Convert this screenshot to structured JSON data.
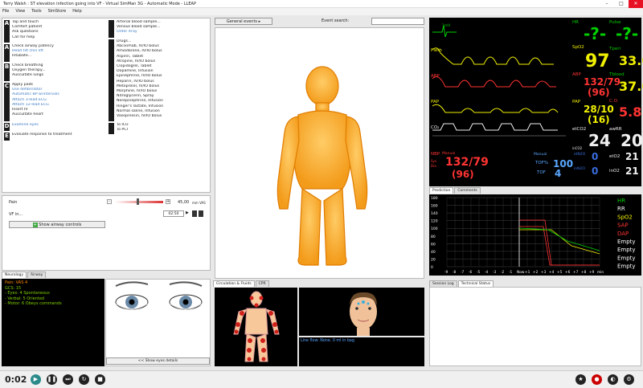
{
  "window": {
    "title": "Terry Walsh : ST elevation infection going into VF - Virtual SimMan 3G - Automatic Mode - LLEAP"
  },
  "menu": [
    "File",
    "View",
    "Tools",
    "SimStore",
    "Help"
  ],
  "actions": {
    "A": [
      "Tap and touch",
      "Comfort patient",
      "Ask questions",
      "Call for help"
    ],
    "A2": [
      "Check airway patency",
      "Head tilt chin lift",
      "Intubate..."
    ],
    "B": [
      "Check breathing",
      "Oxygen therapy...",
      "Auscultate lungs"
    ],
    "C": [
      "Apply pads",
      "Use defibrillator",
      "Automatic BP w/intervals",
      "Attach 3-lead ECG",
      "Attach 12-lead ECG",
      "Insert IV",
      "Auscultate heart"
    ],
    "D": [
      "Examine eyes"
    ],
    "E": [
      "Evaluate response to treatment"
    ],
    "R": [
      "Arterial blood sample...",
      "Venous blood sample...",
      "Order Xray"
    ],
    "Drugs": [
      "Drugs...",
      "Abciximab, IV/IO bolus",
      "Amiodarone, IV/IO bolus",
      "Aspirin, Tablet",
      "Atropine, IV/IO bolus",
      "Clopidogrel, Tablet",
      "Dopamine, Infusion",
      "Epinephrine, IV/IO bolus",
      "Heparin, IV/IO bolus",
      "Metoprolol, IV/IO bolus",
      "Morphine, IV/IO bolus",
      "Nitroglycerin, Spray",
      "Norepinephrine, Infusion",
      "Ringer's lactate, Infusion",
      "Normal saline, Infusion",
      "Vasopressin, IV/IO bolus"
    ],
    "Transfer": [
      "To ICU",
      "To PCI"
    ]
  },
  "pain": {
    "label": "Pain",
    "value": "45,00",
    "unit": "mm VAS"
  },
  "vf": {
    "label": "VF in...",
    "time": "02:50"
  },
  "airway_btn": "Show airway controls",
  "general_events": "General events",
  "event_search": "Event search:",
  "neuro": {
    "tabs": [
      "Neurology",
      "Airway"
    ],
    "lines": [
      "Pain: VAS 4",
      "GCS: 15",
      "- Eyes: 4 Spontaneous",
      "- Verbal: 5 Oriented",
      "- Motor: 6 Obeys commands"
    ],
    "eyes_btn": "<< Show eyes details"
  },
  "circ": {
    "tabs": [
      "Circulation & Fluids",
      "CPR"
    ],
    "flow": "Line flow: None. 0 ml in bag"
  },
  "monitor": {
    "hr_lbl": "HR",
    "hr_sub": "120\n50",
    "hr": "-?-",
    "pulse_lbl": "Pulse",
    "pulse_sub": "130\n50",
    "pulse": "-?-",
    "ecg_scale": "1mV",
    "spo2_lbl": "SpO2",
    "spo2_sub": "100\n90",
    "spo2": "97",
    "tperi_lbl": "Tperi",
    "tperi_sub": "39.0\n35.0",
    "tperi": "33.0",
    "abp_lbl": "ABP",
    "abp": "132/79",
    "abp_mean": "(96)",
    "tblood_lbl": "Tblood",
    "tblood_sub": "39.0\n36.0",
    "tblood": "37.0",
    "pap_lbl": "PAP",
    "pap": "28/10",
    "pap_mean": "(16)",
    "co_lbl": "C.O.",
    "co": "5.8",
    "etco2_lbl": "etCO2",
    "etco2_sub": "50\n25",
    "etco2": "24",
    "awrr_lbl": "awRR",
    "awrr_sub": "25\n8",
    "awrr": "20",
    "inco2_lbl": "inCO2",
    "inco2": "0",
    "nbp_lbl": "NBP",
    "nbp_mode": "Manual",
    "nbp_sys": "Sys.",
    "nbp_dia": "Dia.",
    "nbp": "132/79",
    "nbp_mean": "(96)",
    "tof_mode": "Manual",
    "tofp_lbl": "TOF%",
    "tofp": "100",
    "tof_lbl": "TOF",
    "tof": "4",
    "etn2o_lbl": "etN2O",
    "etn2o": "0",
    "inn2o_lbl": "inN2O",
    "inn2o": "0",
    "eto2_lbl": "etO2",
    "eto2": "21",
    "ino2_lbl": "inO2",
    "ino2": "21",
    "abp_scale": [
      "200",
      "0"
    ],
    "pap_scale": [
      "25",
      "0"
    ],
    "co2_scale": [
      "50",
      "0"
    ]
  },
  "prediction": {
    "tabs": [
      "Prediction",
      "Comments"
    ],
    "yticks": [
      "180",
      "160",
      "140",
      "120",
      "100",
      "80",
      "60",
      "40",
      "20",
      "0"
    ],
    "xticks": [
      "-9",
      "-8",
      "-7",
      "-6",
      "-5",
      "-4",
      "-3",
      "-2",
      "-1",
      "Now",
      "+1",
      "+2",
      "+3",
      "+4",
      "+5",
      "+6",
      "+7",
      "+8",
      "+9",
      "min"
    ],
    "legend": [
      {
        "n": "HR",
        "c": "#00d000"
      },
      {
        "n": "RR",
        "c": "#ffffff"
      },
      {
        "n": "SpO2",
        "c": "#f0f000"
      },
      {
        "n": "SAP",
        "c": "#ff3333"
      },
      {
        "n": "DAP",
        "c": "#ff3333"
      },
      {
        "n": "Empty",
        "c": "#ffffff"
      },
      {
        "n": "Empty",
        "c": "#ffffff"
      },
      {
        "n": "Empty",
        "c": "#ffffff"
      },
      {
        "n": "Empty",
        "c": "#ffffff"
      }
    ]
  },
  "log": {
    "tabs": [
      "Session Log",
      "Technical Status"
    ]
  },
  "timer": "0:02"
}
